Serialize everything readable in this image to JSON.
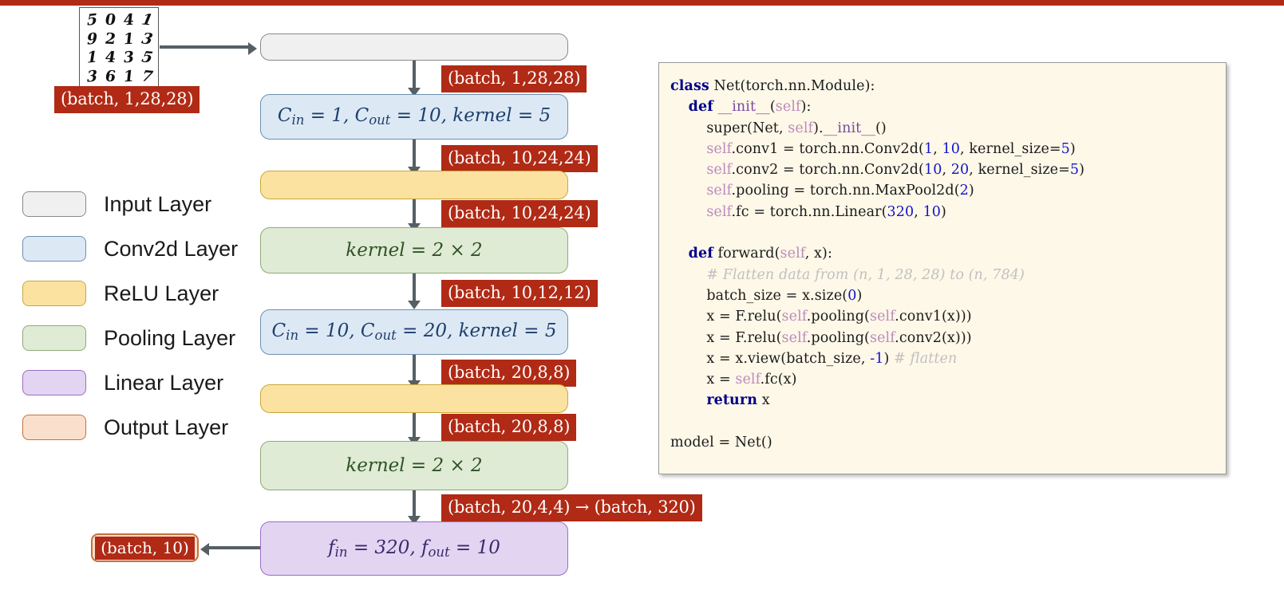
{
  "top_bar": {
    "color": "#B02A15"
  },
  "sample_image": {
    "name": "mnist-digit-grid",
    "rows": [
      [
        "5",
        "0",
        "4",
        "1"
      ],
      [
        "9",
        "2",
        "1",
        "3"
      ],
      [
        "1",
        "4",
        "3",
        "5"
      ],
      [
        "3",
        "6",
        "1",
        "7"
      ]
    ],
    "shape_tag": "(batch, 1,28,28)"
  },
  "legend": {
    "items": [
      {
        "label": "Input Layer",
        "fill": "#F0F0F0",
        "border": "#8A8A8A",
        "name": "input"
      },
      {
        "label": "Conv2d Layer",
        "fill": "#DCE9F5",
        "border": "#6E8FAD",
        "name": "conv2d"
      },
      {
        "label": "ReLU Layer",
        "fill": "#FBE2A0",
        "border": "#C9A83C",
        "name": "relu"
      },
      {
        "label": "Pooling Layer",
        "fill": "#DFEBD4",
        "border": "#8FA97C",
        "name": "pooling"
      },
      {
        "label": "Linear Layer",
        "fill": "#E3D4F2",
        "border": "#9A6FC4",
        "name": "linear"
      },
      {
        "label": "Output Layer",
        "fill": "#FAE0CC",
        "border": "#C8703C",
        "name": "output"
      }
    ]
  },
  "flow": {
    "boxes": [
      {
        "name": "input-layer",
        "type": "Input Layer",
        "text": "",
        "fill": "#F0F0F0",
        "border": "#8A8A8A",
        "text_color": "#333333"
      },
      {
        "name": "conv2d-1",
        "type": "Conv2d Layer",
        "text": "C_in = 1, C_out = 10, kernel = 5",
        "fill": "#DCE9F5",
        "border": "#6E8FAD",
        "text_color": "#1F3F6B"
      },
      {
        "name": "relu-1",
        "type": "ReLU Layer",
        "text": "",
        "fill": "#FBE2A0",
        "border": "#C9A83C",
        "text_color": "#6B5400"
      },
      {
        "name": "pooling-1",
        "type": "Pooling Layer",
        "text": "kernel = 2 × 2",
        "fill": "#DFEBD4",
        "border": "#8FA97C",
        "text_color": "#2F5225"
      },
      {
        "name": "conv2d-2",
        "type": "Conv2d Layer",
        "text": "C_in = 10, C_out = 20, kernel = 5",
        "fill": "#DCE9F5",
        "border": "#6E8FAD",
        "text_color": "#1F3F6B"
      },
      {
        "name": "relu-2",
        "type": "ReLU Layer",
        "text": "",
        "fill": "#FBE2A0",
        "border": "#C9A83C",
        "text_color": "#6B5400"
      },
      {
        "name": "pooling-2",
        "type": "Pooling Layer",
        "text": "kernel = 2 × 2",
        "fill": "#DFEBD4",
        "border": "#8FA97C",
        "text_color": "#2F5225"
      },
      {
        "name": "linear",
        "type": "Linear Layer",
        "text": "f_in = 320, f_out = 10",
        "fill": "#E3D4F2",
        "border": "#9A6FC4",
        "text_color": "#3B2A6B"
      }
    ],
    "shape_tags": [
      "(batch, 1,28,28)",
      "(batch, 10,24,24)",
      "(batch, 10,24,24)",
      "(batch, 10,12,12)",
      "(batch, 20,8,8)",
      "(batch, 20,8,8)",
      "(batch, 20,4,4) → (batch, 320)"
    ],
    "output_tag": "(batch, 10)"
  },
  "code_panel": {
    "background": "#FDF8E8",
    "lines": [
      "class Net(torch.nn.Module):",
      "    def __init__(self):",
      "        super(Net, self).__init__()",
      "        self.conv1 = torch.nn.Conv2d(1, 10, kernel_size=5)",
      "        self.conv2 = torch.nn.Conv2d(10, 20, kernel_size=5)",
      "        self.pooling = torch.nn.MaxPool2d(2)",
      "        self.fc = torch.nn.Linear(320, 10)",
      "",
      "    def forward(self, x):",
      "        # Flatten data from (n, 1, 28, 28) to (n, 784)",
      "        batch_size = x.size(0)",
      "        x = F.relu(self.pooling(self.conv1(x)))",
      "        x = F.relu(self.pooling(self.conv2(x)))",
      "        x = x.view(batch_size, -1) # flatten",
      "        x = self.fc(x)",
      "        return x",
      "",
      "model = Net()"
    ]
  }
}
